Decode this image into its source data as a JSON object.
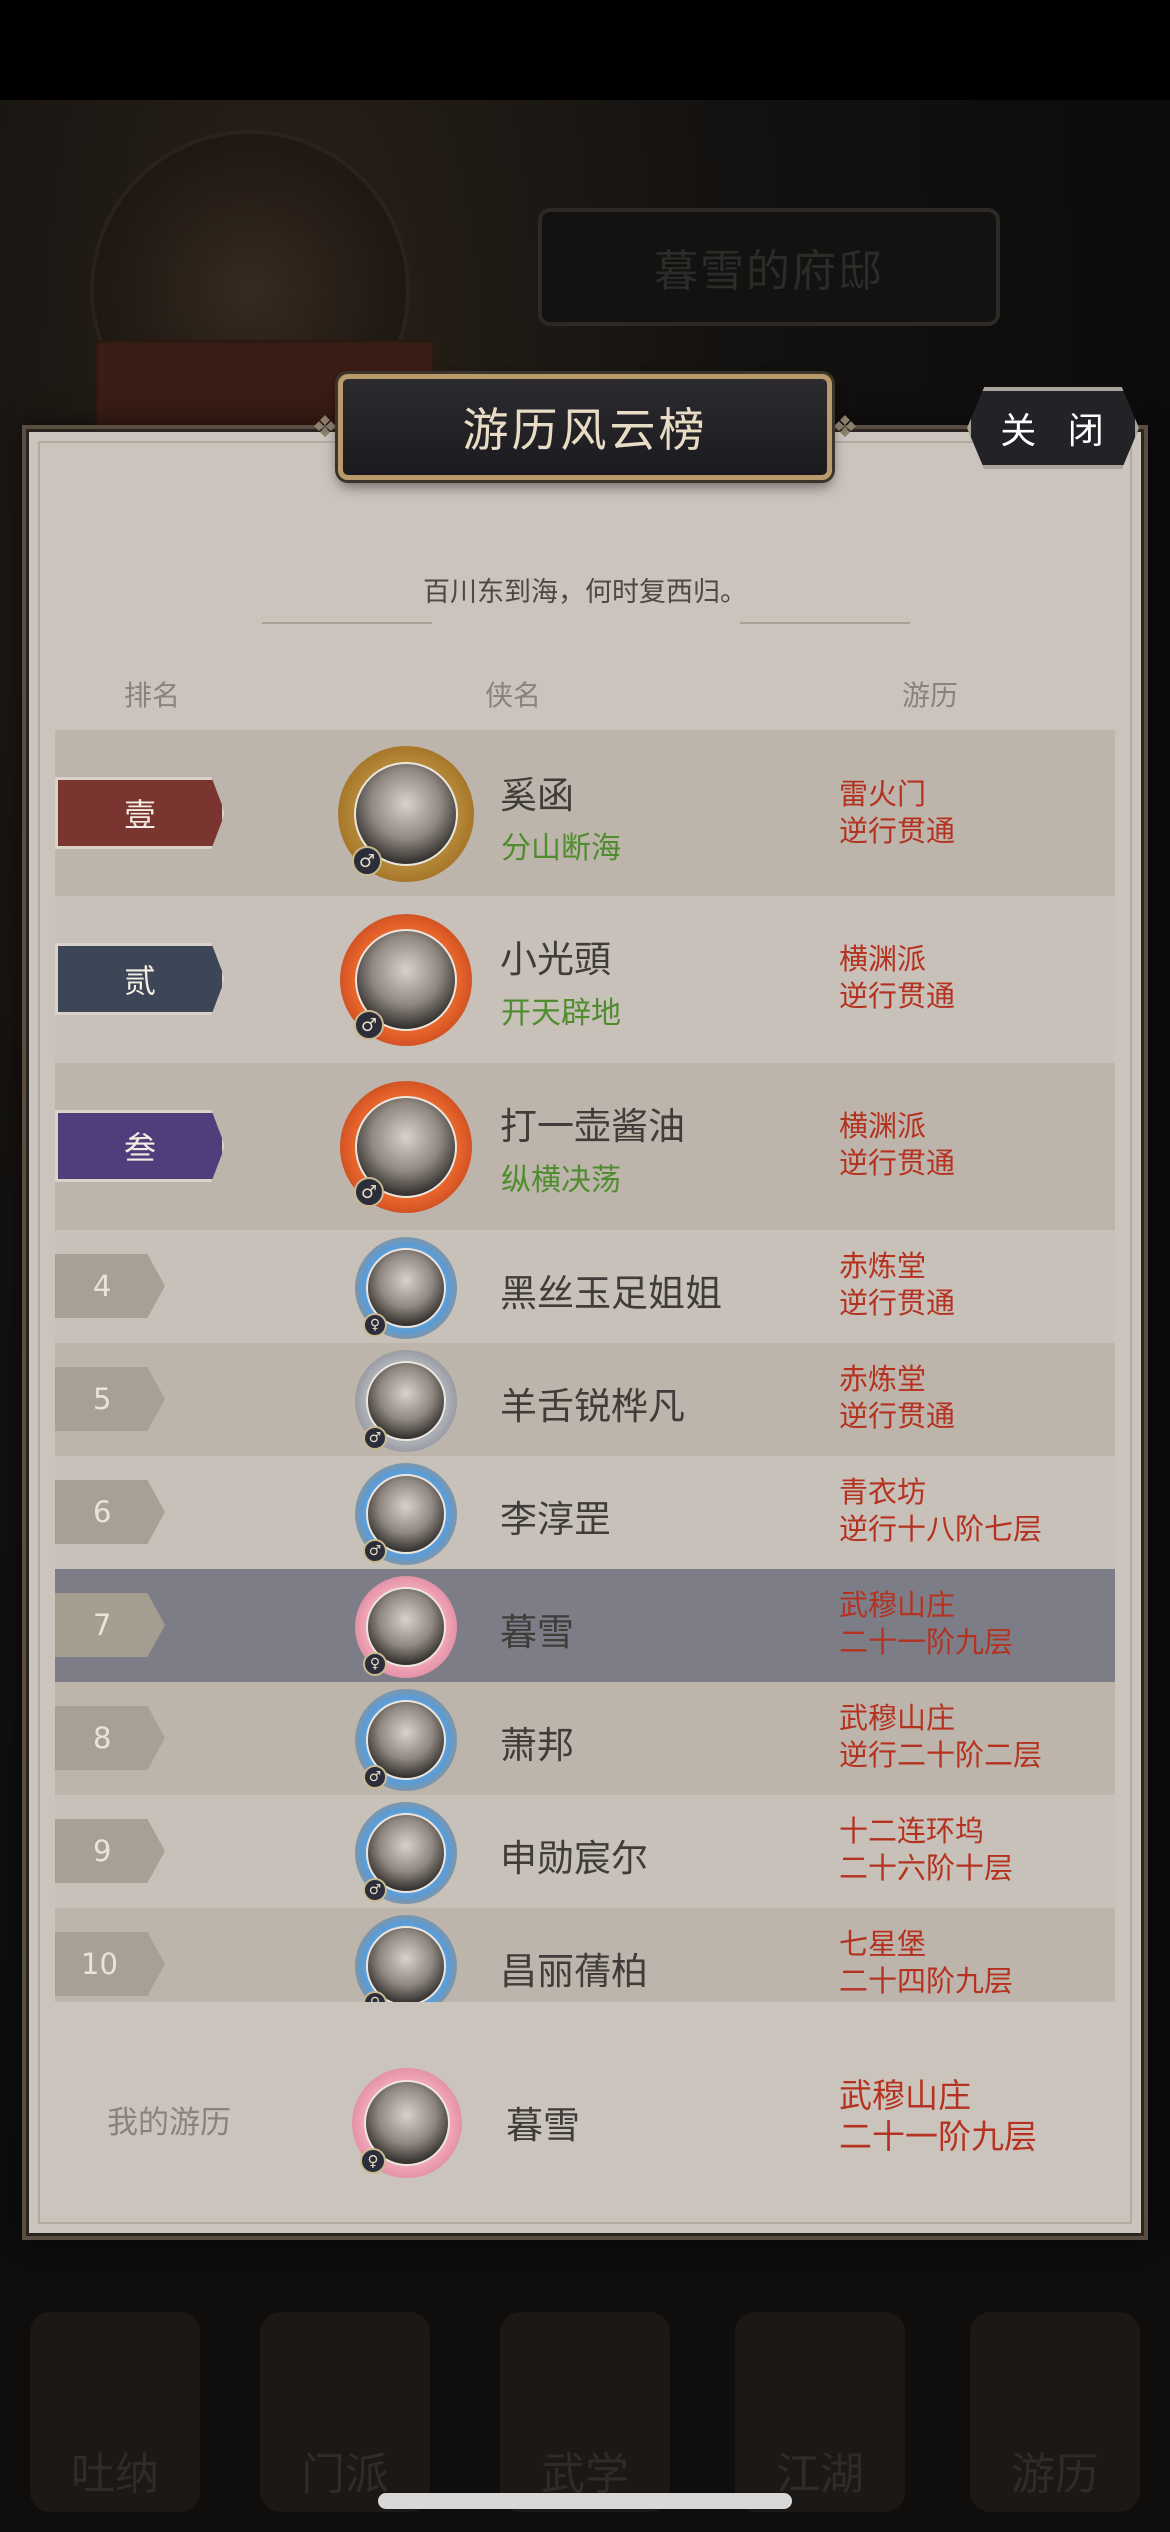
{
  "background": {
    "residence_title": "暮雪的府邸",
    "nav_items": [
      "吐纳",
      "门派",
      "武学",
      "江湖",
      "游历"
    ]
  },
  "panel": {
    "title": "游历风云榜",
    "close_label": "关 闭",
    "motto": "百川东到海，何时复西归。",
    "columns": {
      "rank": "排名",
      "name": "侠名",
      "progress": "游历"
    }
  },
  "rankings": [
    {
      "rank": "壹",
      "name": "奚函",
      "subtitle": "分山断海",
      "sect": "雷火门",
      "stage": "逆行贯通",
      "gender": "♂",
      "frame": "gold",
      "banner_color": "#7a3531"
    },
    {
      "rank": "贰",
      "name": "小光頭",
      "subtitle": "开天辟地",
      "sect": "横渊派",
      "stage": "逆行贯通",
      "gender": "♂",
      "frame": "fire",
      "banner_color": "#3c4656"
    },
    {
      "rank": "叁",
      "name": "打一壶酱油",
      "subtitle": "纵横决荡",
      "sect": "横渊派",
      "stage": "逆行贯通",
      "gender": "♂",
      "frame": "fire",
      "banner_color": "#4f3d7c"
    },
    {
      "rank": "4",
      "name": "黑丝玉足姐姐",
      "sect": "赤炼堂",
      "stage": "逆行贯通",
      "gender": "♀",
      "frame": "flame-blue"
    },
    {
      "rank": "5",
      "name": "羊舌锐桦凡",
      "sect": "赤炼堂",
      "stage": "逆行贯通",
      "gender": "♂",
      "frame": "cloud"
    },
    {
      "rank": "6",
      "name": "李淳罡",
      "sect": "青衣坊",
      "stage": "逆行十八阶七层",
      "gender": "♂",
      "frame": "flame-blue"
    },
    {
      "rank": "7",
      "name": "暮雪",
      "sect": "武穆山庄",
      "stage": "二十一阶九层",
      "gender": "♀",
      "frame": "flower",
      "is_me": true
    },
    {
      "rank": "8",
      "name": "萧邦",
      "sect": "武穆山庄",
      "stage": "逆行二十阶二层",
      "gender": "♂",
      "frame": "flame-blue"
    },
    {
      "rank": "9",
      "name": "申勋宸尔",
      "sect": "十二连环坞",
      "stage": "二十六阶十层",
      "gender": "♂",
      "frame": "flame-blue"
    },
    {
      "rank": "10",
      "name": "昌丽蒨柏",
      "sect": "七星堡",
      "stage": "二十四阶九层",
      "gender": "♀",
      "frame": "flame-blue"
    }
  ],
  "my_entry": {
    "label": "我的游历",
    "name": "暮雪",
    "sect": "武穆山庄",
    "stage": "二十一阶九层",
    "gender": "♀"
  }
}
